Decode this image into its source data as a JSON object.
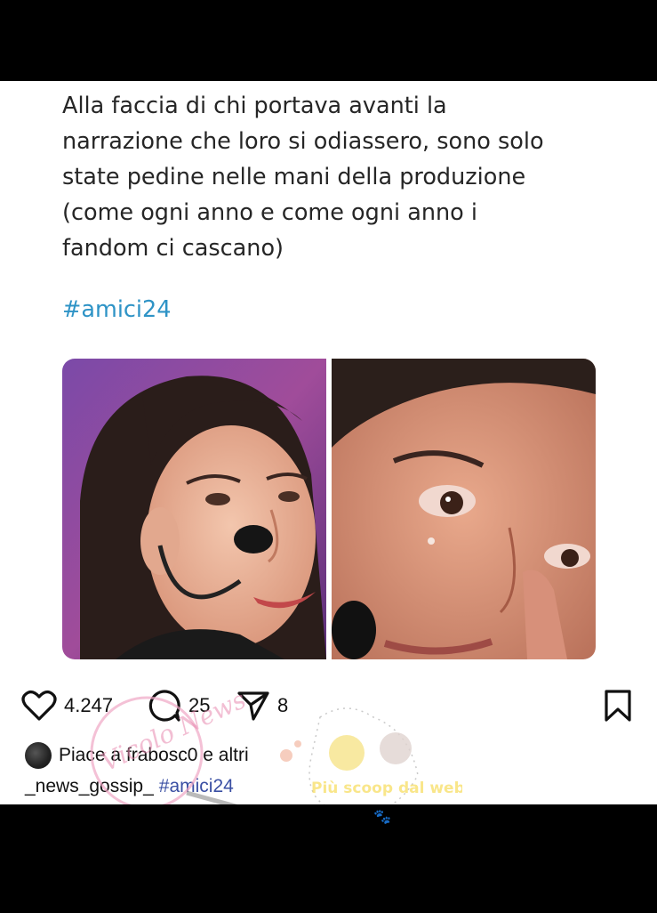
{
  "post": {
    "text_lines": [
      "Alla faccia di chi portava avanti la",
      "narrazione che loro si odiassero, sono solo",
      "state pedine nelle mani della produzione",
      "(come ogni anno e come ogni anno i",
      "fandom ci cascano)"
    ],
    "hashtag": "#amici24"
  },
  "actions": {
    "likes_count": "4.247",
    "comments_count": "25",
    "shares_count": "8",
    "icons": [
      "heart-icon",
      "comment-icon",
      "share-icon",
      "bookmark-icon"
    ]
  },
  "liked_by": {
    "text": "Piace a frabosc0 e altri"
  },
  "caption": {
    "username": "_news_gossip_",
    "hashtag": "#amici24"
  },
  "watermark": {
    "text_left": "Vicolo News",
    "text_right": "Più scoop dal web"
  },
  "colors": {
    "background": "#000000",
    "card": "#ffffff",
    "hashtag_blue": "#2e93c6",
    "caption_tag": "#3a4fa3"
  }
}
